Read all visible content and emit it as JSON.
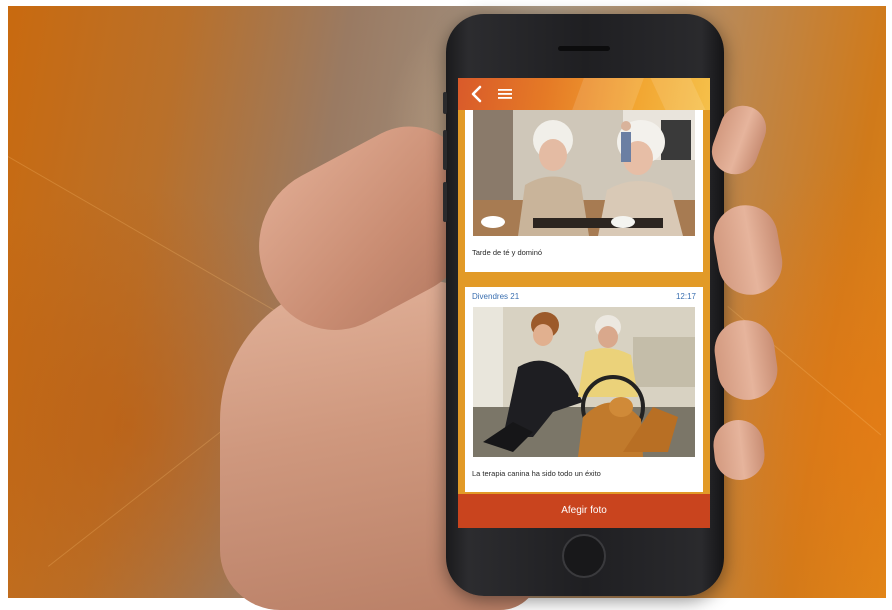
{
  "app": {
    "header": {
      "back_icon": "chevron-left-icon",
      "menu_icon": "hamburger-menu-icon"
    },
    "feed": [
      {
        "date": "",
        "time": "",
        "photo": "two elderly women playing dominoes with tea cups",
        "caption": "Tarde de té y dominó"
      },
      {
        "date": "Divendres 21",
        "time": "12:17",
        "photo": "woman and elderly man in wheelchair petting a golden dog",
        "caption": "La terapia canina ha sido todo un éxito"
      }
    ],
    "action_button": {
      "label": "Afegir foto"
    }
  },
  "colors": {
    "header_start": "#d95a2a",
    "header_end": "#f5c04a",
    "feed_background": "#e29a27",
    "action_bar": "#c9441e",
    "date_text": "#3a6fb0"
  }
}
